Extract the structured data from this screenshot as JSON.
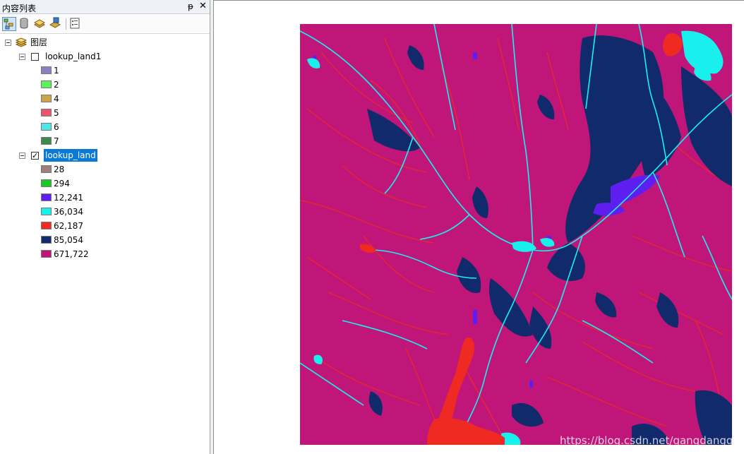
{
  "toc": {
    "title": "内容列表",
    "pin_glyph": "ᵽ",
    "close_glyph": "✕",
    "toolbar": [
      {
        "name": "list-by-drawing-order"
      },
      {
        "name": "list-by-source"
      },
      {
        "name": "list-by-visibility"
      },
      {
        "name": "list-by-selection"
      },
      {
        "name": "options"
      }
    ],
    "root": {
      "label": "图层"
    },
    "layers": [
      {
        "label": "lookup_land1",
        "checked": false,
        "selected": false,
        "classes": [
          {
            "label": "1",
            "color": "#8a80c0"
          },
          {
            "label": "2",
            "color": "#5cf25c"
          },
          {
            "label": "4",
            "color": "#c9a44a"
          },
          {
            "label": "5",
            "color": "#e8566c"
          },
          {
            "label": "6",
            "color": "#4ee6e6"
          },
          {
            "label": "7",
            "color": "#3f8a4a"
          }
        ]
      },
      {
        "label": "lookup_land",
        "checked": true,
        "selected": true,
        "classes": [
          {
            "label": "28",
            "color": "#9c7f7a"
          },
          {
            "label": "294",
            "color": "#19c824"
          },
          {
            "label": "12,241",
            "color": "#5f1ef0"
          },
          {
            "label": "36,034",
            "color": "#19f0ee"
          },
          {
            "label": "62,187",
            "color": "#ee2a22"
          },
          {
            "label": "85,054",
            "color": "#102a6c"
          },
          {
            "label": "671,722",
            "color": "#c0167a"
          }
        ]
      }
    ]
  },
  "map": {
    "colors": {
      "background": "#c0167a",
      "dark": "#102a6c",
      "cyan": "#19f0ee",
      "red": "#ee2a22",
      "blue": "#5f1ef0"
    }
  },
  "watermark": "https://blog.csdn.net/gangdanggood"
}
